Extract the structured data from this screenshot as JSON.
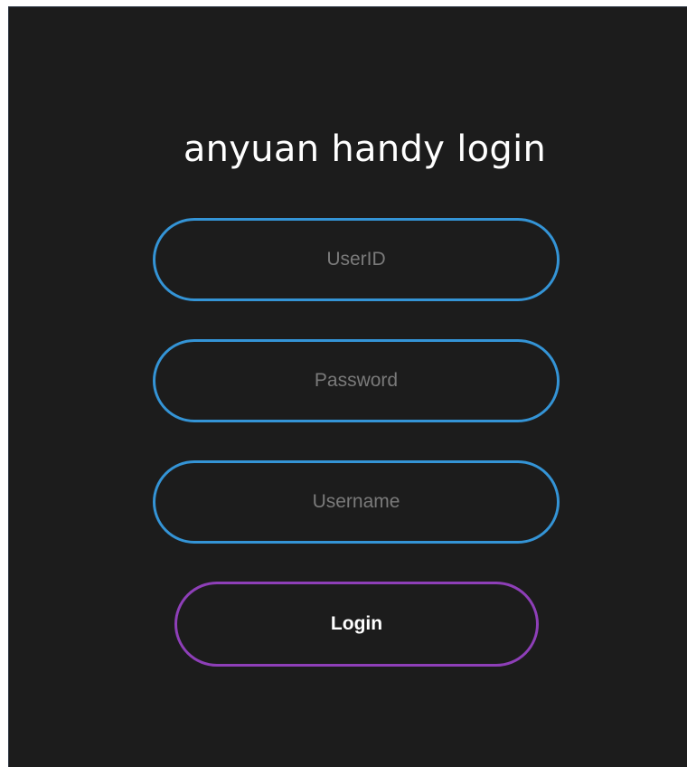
{
  "login": {
    "title": "anyuan handy login",
    "userid_placeholder": "UserID",
    "password_placeholder": "Password",
    "username_placeholder": "Username",
    "login_label": "Login"
  },
  "colors": {
    "background": "#1c1c1c",
    "input_border": "#3494d6",
    "button_border": "#8e3fb8",
    "title_text": "#ffffff",
    "placeholder_text": "#7a7a7a"
  }
}
